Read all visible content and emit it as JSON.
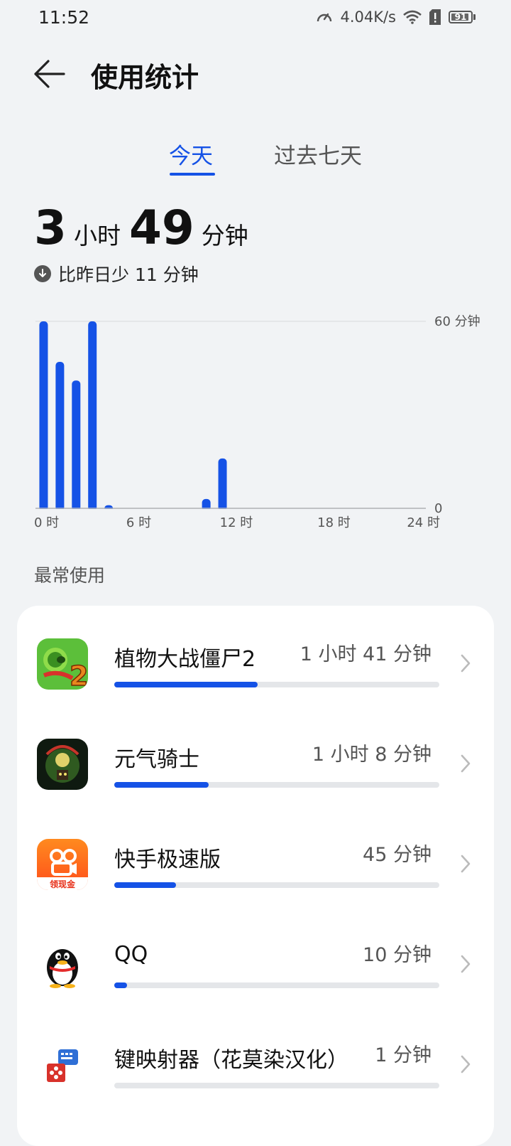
{
  "status": {
    "time": "11:52",
    "net_speed": "4.04K/s",
    "battery": "91",
    "battery_level": 0.91
  },
  "header": {
    "title": "使用统计"
  },
  "tabs": [
    {
      "label": "今天",
      "active": true
    },
    {
      "label": "过去七天",
      "active": false
    }
  ],
  "summary": {
    "hours": "3",
    "hours_unit": "小时",
    "minutes": "49",
    "minutes_unit": "分钟",
    "compare_text": "比昨日少 11 分钟"
  },
  "chart_data": {
    "type": "bar",
    "x": [
      0,
      1,
      2,
      3,
      4,
      5,
      6,
      7,
      8,
      9,
      10,
      11,
      12,
      13,
      14,
      15,
      16,
      17,
      18,
      19,
      20,
      21,
      22,
      23
    ],
    "values": [
      60,
      47,
      41,
      60,
      1,
      0,
      0,
      0,
      0,
      0,
      3,
      16,
      0,
      0,
      0,
      0,
      0,
      0,
      0,
      0,
      0,
      0,
      0,
      0
    ],
    "xticks": [
      "0 时",
      "6 时",
      "12 时",
      "18 时",
      "24 时"
    ],
    "ylim": [
      0,
      60
    ],
    "y_top_label": "60 分钟",
    "y_bottom_label": "0",
    "bar_color": "#1552e6"
  },
  "most_used": {
    "title": "最常使用",
    "apps": [
      {
        "name": "植物大战僵尸2",
        "time": "1 小时 41 分钟",
        "fraction": 0.44,
        "icon": "plants-vs-zombies-icon"
      },
      {
        "name": "元气骑士",
        "time": "1 小时 8 分钟",
        "fraction": 0.29,
        "icon": "soul-knight-icon"
      },
      {
        "name": "快手极速版",
        "time": "45 分钟",
        "fraction": 0.19,
        "icon": "kuaishou-icon",
        "badge": "领现金"
      },
      {
        "name": "QQ",
        "time": "10 分钟",
        "fraction": 0.04,
        "icon": "qq-penguin-icon"
      },
      {
        "name": "键映射器（花莫染汉化）",
        "time": "1 分钟",
        "fraction": 0.0,
        "icon": "key-mapper-icon"
      }
    ]
  },
  "colors": {
    "accent": "#1552e6",
    "background": "#f1f3f5",
    "card": "#ffffff"
  }
}
